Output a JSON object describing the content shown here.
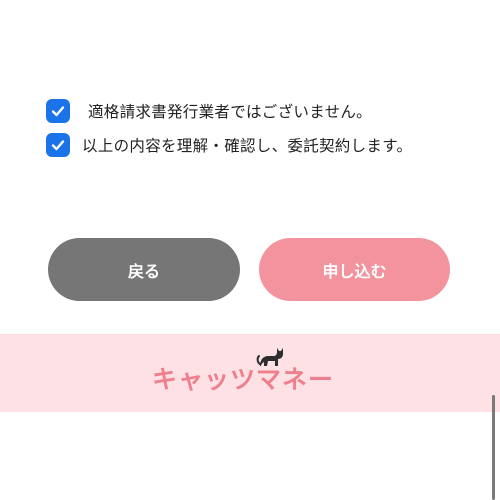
{
  "checkboxes": [
    {
      "label": "適格請求書発行業者ではございません。",
      "checked": true
    },
    {
      "label": "以上の内容を理解・確認し、委託契約します。",
      "checked": true
    }
  ],
  "buttons": {
    "back_label": "戻る",
    "apply_label": "申し込む"
  },
  "footer": {
    "logo_text": "キャッツマネー"
  },
  "colors": {
    "checkbox": "#1a73e8",
    "back_button": "#767676",
    "apply_button": "#f3939e",
    "footer_band": "#fde1e5",
    "logo": "#ef7f8c"
  }
}
